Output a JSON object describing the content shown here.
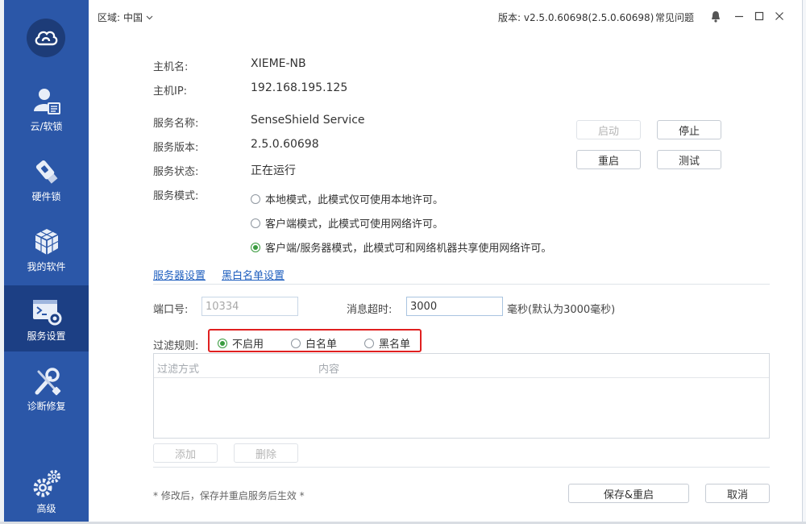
{
  "topbar": {
    "region_label": "区域:",
    "region_value": "中国",
    "version_text": "版本: v2.5.0.60698(2.5.0.60698)",
    "faq_label": "常见问题"
  },
  "sidebar": {
    "items": [
      {
        "label": "云/软锁",
        "icon": "user-card-icon"
      },
      {
        "label": "硬件锁",
        "icon": "usb-key-icon"
      },
      {
        "label": "我的软件",
        "icon": "cubes-icon"
      },
      {
        "label": "服务设置",
        "icon": "terminal-gear-icon",
        "active": true
      },
      {
        "label": "诊断修复",
        "icon": "wrench-screwdriver-icon"
      },
      {
        "label": "高级",
        "icon": "gears-icon"
      }
    ]
  },
  "info": {
    "host_name_label": "主机名:",
    "host_name_value": "XIEME-NB",
    "host_ip_label": "主机IP:",
    "host_ip_value": "192.168.195.125",
    "service_name_label": "服务名称:",
    "service_name_value": "SenseShield Service",
    "service_version_label": "服务版本:",
    "service_version_value": "2.5.0.60698",
    "service_status_label": "服务状态:",
    "service_status_value": "正在运行",
    "service_mode_label": "服务模式:"
  },
  "service_buttons": {
    "start": "启动",
    "stop": "停止",
    "restart": "重启",
    "test": "测试"
  },
  "modes": [
    {
      "label": "本地模式，此模式仅可使用本地许可。",
      "checked": false
    },
    {
      "label": "客户端模式，此模式可使用网络许可。",
      "checked": false
    },
    {
      "label": "客户端/服务器模式，此模式可和网络机器共享使用网络许可。",
      "checked": true
    }
  ],
  "tabs": {
    "server_settings": "服务器设置",
    "blacklist_settings": "黑白名单设置"
  },
  "server": {
    "port_label": "端口号:",
    "port_value": "10334",
    "timeout_label": "消息超时:",
    "timeout_value": "3000",
    "timeout_unit": "毫秒(默认为3000毫秒)"
  },
  "filter": {
    "label": "过滤规则:",
    "options": [
      {
        "label": "不启用",
        "checked": true
      },
      {
        "label": "白名单",
        "checked": false
      },
      {
        "label": "黑名单",
        "checked": false
      }
    ],
    "columns": [
      "过滤方式",
      "内容"
    ],
    "add_button": "添加",
    "delete_button": "删除"
  },
  "footer": {
    "note": "* 修改后，保存并重启服务后生效 *",
    "save_button": "保存&重启",
    "cancel_button": "取消"
  },
  "colors": {
    "sidebar": "#2b57a8",
    "sidebar_active": "#1c3f84",
    "link": "#1f5fbf",
    "checked": "#3a9b3f",
    "highlight_box": "#e02020"
  }
}
